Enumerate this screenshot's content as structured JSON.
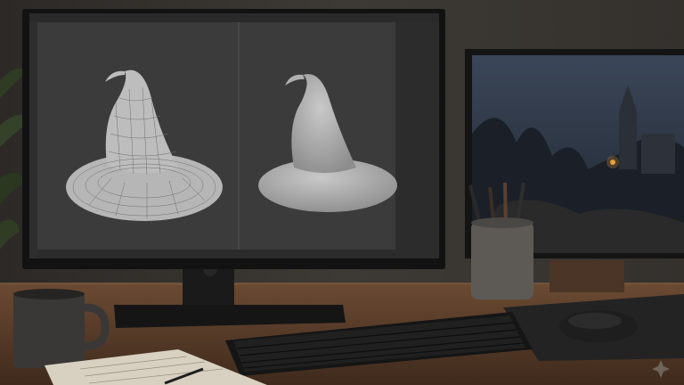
{
  "scene": {
    "description_tags": [
      "desk",
      "monitor",
      "3d-modeling"
    ],
    "colors": {
      "wall": "#3a3733",
      "desk": "#5a3d2a",
      "monitor_frame": "#121212",
      "viewport_bg": "#404040",
      "hat_wire": "#b8b8b8",
      "hat_shaded": "#a9a9a9",
      "second_screen": "#2a3240"
    }
  },
  "main_monitor": {
    "app": "3d-modeling-software",
    "viewport_left": "wireframe-hat",
    "viewport_right": "shaded-hat"
  },
  "second_monitor": {
    "content": "fantasy-landscape-render"
  },
  "icons": {
    "mug": "mug-icon",
    "keyboard": "keyboard-icon",
    "mouse": "mouse-icon",
    "pencil_cup": "pencil-cup-icon",
    "plant": "plant-icon",
    "notebook": "notebook-icon",
    "watermark": "sparkle-icon"
  }
}
